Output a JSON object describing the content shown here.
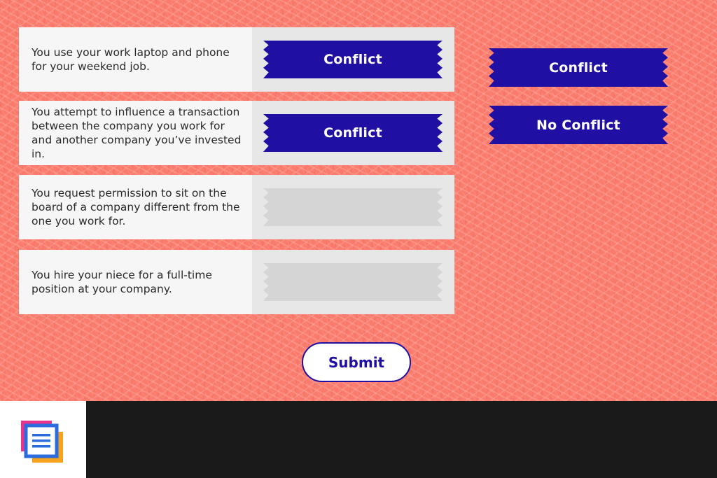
{
  "statements": [
    {
      "text": "You use your work laptop and phone for your weekend job.",
      "answer": "Conflict",
      "filled": true
    },
    {
      "text": "You attempt to influence a transaction between the company you work for and another company you’ve invested in.",
      "answer": "Conflict",
      "filled": true
    },
    {
      "text": "You request permission to sit on the board of a company different from the one you work for.",
      "answer": "",
      "filled": false
    },
    {
      "text": "You hire your niece for a full-time position at your company.",
      "answer": "",
      "filled": false
    }
  ],
  "choices": [
    "Conflict",
    "No Conflict"
  ],
  "submit_label": "Submit",
  "colors": {
    "background": "#fa7b6c",
    "accent": "#1f0fa3",
    "slot_empty": "#d5d5d5"
  },
  "footer": {
    "icon": "document-icon"
  }
}
